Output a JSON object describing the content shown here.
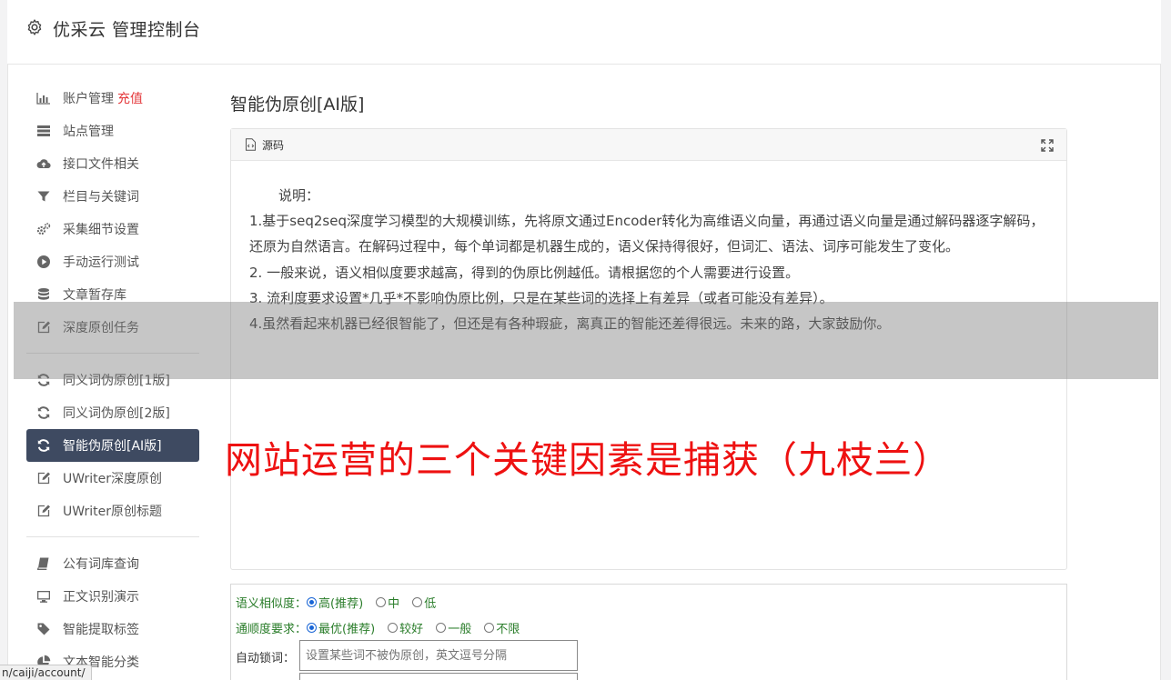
{
  "header": {
    "title": "优采云 管理控制台"
  },
  "sidebar": {
    "group1": [
      {
        "label": "账户管理",
        "extra": "充值",
        "icon": "bar-chart-icon"
      },
      {
        "label": "站点管理",
        "icon": "server-icon"
      },
      {
        "label": "接口文件相关",
        "icon": "cloud-upload-icon"
      },
      {
        "label": "栏目与关键词",
        "icon": "filter-icon"
      },
      {
        "label": "采集细节设置",
        "icon": "gears-icon"
      },
      {
        "label": "手动运行测试",
        "icon": "play-circle-icon"
      },
      {
        "label": "文章暂存库",
        "icon": "database-icon"
      },
      {
        "label": "深度原创任务",
        "icon": "edit-icon"
      }
    ],
    "group2": [
      {
        "label": "同义词伪原创[1版]",
        "icon": "refresh-icon"
      },
      {
        "label": "同义词伪原创[2版]",
        "icon": "refresh-icon"
      },
      {
        "label": "智能伪原创[AI版]",
        "icon": "refresh-icon",
        "active": true
      },
      {
        "label": "UWriter深度原创",
        "icon": "edit-icon"
      },
      {
        "label": "UWriter原创标题",
        "icon": "edit-icon"
      }
    ],
    "group3": [
      {
        "label": "公有词库查询",
        "icon": "book-icon"
      },
      {
        "label": "正文识别演示",
        "icon": "monitor-icon"
      },
      {
        "label": "智能提取标签",
        "icon": "tag-icon"
      },
      {
        "label": "文本智能分类",
        "icon": "pie-chart-icon"
      }
    ]
  },
  "main": {
    "title": "智能伪原创[AI版]",
    "panel": {
      "tab_label": "源码",
      "intro": "说明：",
      "lines": [
        "1.基于seq2seq深度学习模型的大规模训练，先将原文通过Encoder转化为高维语义向量，再通过语义向量是通过解码器逐字解码，还原为自然语言。在解码过程中，每个单词都是机器生成的，语义保持得很好，但词汇、语法、词序可能发生了变化。",
        "2. 一般来说，语义相似度要求越高，得到的伪原比例越低。请根据您的个人需要进行设置。",
        "3. 流利度要求设置*几乎*不影响伪原比例，只是在某些词的选择上有差异（或者可能没有差异）。",
        "4.虽然看起来机器已经很智能了，但还是有各种瑕疵，离真正的智能还差得很远。未来的路，大家鼓励你。"
      ]
    },
    "overlay_headline": "网站运营的三个关键因素是捕获（九枝兰）",
    "form": {
      "similarity": {
        "label": "语义相似度：",
        "options": [
          {
            "label": "高(推荐)",
            "checked": true
          },
          {
            "label": "中",
            "checked": false
          },
          {
            "label": "低",
            "checked": false
          }
        ]
      },
      "fluency": {
        "label": "通顺度要求：",
        "options": [
          {
            "label": "最优(推荐)",
            "checked": true
          },
          {
            "label": "较好",
            "checked": false
          },
          {
            "label": "一般",
            "checked": false
          },
          {
            "label": "不限",
            "checked": false
          }
        ]
      },
      "lock_words": {
        "label": "自动锁词：",
        "placeholder": "设置某些词不被伪原创，英文逗号分隔"
      }
    }
  },
  "status_bar": {
    "url": "n/caiji/account/"
  }
}
